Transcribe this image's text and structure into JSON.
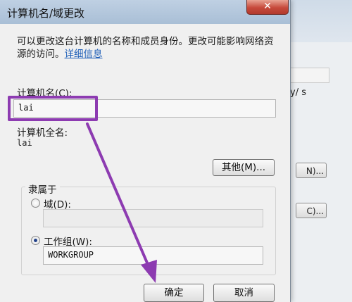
{
  "dialog": {
    "title": "计算机名/域更改",
    "close_glyph": "✕",
    "description": "可以更改这台计算机的名称和成员身份。更改可能影响网络资源的访问。",
    "description_link": "详细信息"
  },
  "computer_name": {
    "label": "计算机名(C):",
    "value": "lai"
  },
  "full_name": {
    "label": "计算机全名:",
    "value": "lai"
  },
  "buttons": {
    "other": "其他(M)...",
    "ok": "确定",
    "cancel": "取消"
  },
  "member_of": {
    "label": "隶属于",
    "domain_label": "域(D):",
    "domain_value": "",
    "workgroup_label": "工作组(W):",
    "workgroup_value": "WORKGROUP",
    "selected": "workgroup"
  },
  "background_window": {
    "partial_text": "y/ s",
    "button_1": "N)...",
    "button_2": "C)..."
  },
  "annotation": {
    "color": "#8d3bb1"
  }
}
